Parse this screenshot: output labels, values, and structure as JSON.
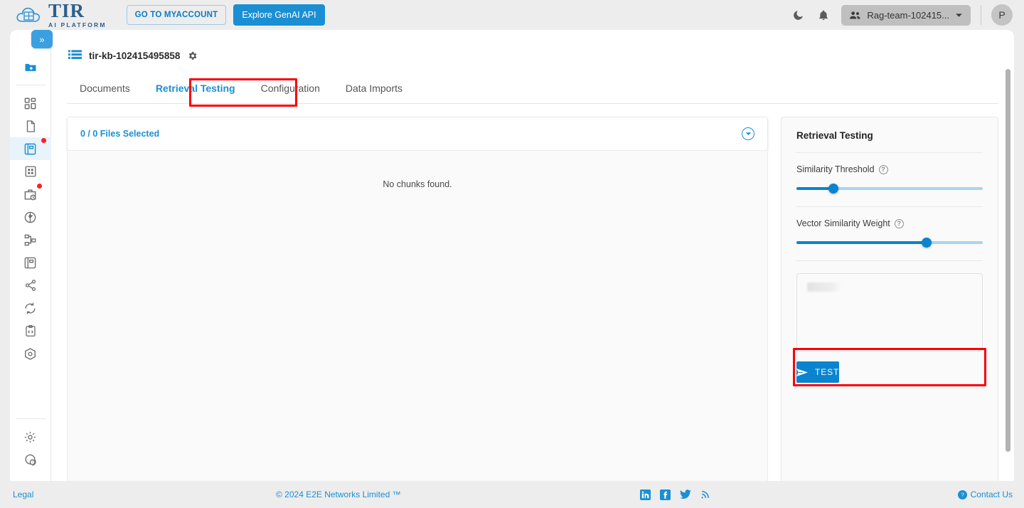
{
  "header": {
    "brand_name": "TIR",
    "brand_sub": "AI PLATFORM",
    "myaccount_label": "GO TO MYACCOUNT",
    "genai_label": "Explore GenAI API",
    "theme_icon": "moon-icon",
    "bell_icon": "bell-icon",
    "team_name": "Rag-team-102415...",
    "team_icon": "people-icon",
    "chevron_icon": "chevron-down-icon",
    "avatar_initial": "P"
  },
  "breadcrumb": {
    "text": ""
  },
  "sidebar": {
    "expander_glyph": "»",
    "items": [
      {
        "name": "new-project-folder",
        "icon": "folder-plus-icon",
        "badge": false,
        "active": false
      },
      {
        "name": "dashboard",
        "icon": "dashboard-grid-icon",
        "badge": false,
        "active": false
      },
      {
        "name": "documents",
        "icon": "file-icon",
        "badge": false,
        "active": false
      },
      {
        "name": "knowledge-base",
        "icon": "book-list-icon",
        "badge": true,
        "active": true
      },
      {
        "name": "datasets",
        "icon": "table-icon",
        "badge": false,
        "active": false
      },
      {
        "name": "jobs",
        "icon": "briefcase-clock-icon",
        "badge": true,
        "active": false
      },
      {
        "name": "inference",
        "icon": "target-node-icon",
        "badge": false,
        "active": false
      },
      {
        "name": "pipelines",
        "icon": "hierarchy-icon",
        "badge": false,
        "active": false
      },
      {
        "name": "registry",
        "icon": "contact-card-icon",
        "badge": false,
        "active": false
      },
      {
        "name": "share",
        "icon": "share-nodes-icon",
        "badge": false,
        "active": false
      },
      {
        "name": "sync",
        "icon": "refresh-cycle-icon",
        "badge": false,
        "active": false
      },
      {
        "name": "code-snippets",
        "icon": "code-clipboard-icon",
        "badge": false,
        "active": false
      },
      {
        "name": "containers",
        "icon": "cube-icon",
        "badge": false,
        "active": false
      }
    ],
    "bottom_items": [
      {
        "name": "settings",
        "icon": "gear-icon"
      },
      {
        "name": "support",
        "icon": "chat-help-icon"
      }
    ]
  },
  "page": {
    "kb_name": "tir-kb-102415495858",
    "kb_icon": "list-blue-icon",
    "settings_icon": "gear-icon",
    "tabs": [
      {
        "label": "Documents",
        "active": false
      },
      {
        "label": "Retrieval Testing",
        "active": true
      },
      {
        "label": "Configuration",
        "active": false
      },
      {
        "label": "Data Imports",
        "active": false
      }
    ]
  },
  "chunks": {
    "files_selected_label": "0 / 0 Files Selected",
    "collapse_icon": "circle-chevron-down-icon",
    "empty_message": "No chunks found."
  },
  "retrieval": {
    "title": "Retrieval Testing",
    "similarity_threshold": {
      "label": "Similarity Threshold",
      "help_icon": "question-circle-icon",
      "value_percent": 20
    },
    "vector_similarity_weight": {
      "label": "Vector Similarity Weight",
      "help_icon": "question-circle-icon",
      "value_percent": 70
    },
    "query_input": {
      "value": "",
      "placeholder": ""
    },
    "test_button": {
      "label": "TEST",
      "icon": "send-paper-plane-icon"
    }
  },
  "footer": {
    "legal": "Legal",
    "copyright": "© 2024 E2E Networks Limited ™",
    "social": [
      {
        "name": "linkedin-icon"
      },
      {
        "name": "facebook-icon"
      },
      {
        "name": "twitter-icon"
      },
      {
        "name": "rss-icon"
      }
    ],
    "contact": "Contact Us",
    "contact_icon": "question-circle-icon"
  },
  "colors": {
    "accent": "#1a8fd4",
    "slider_fill": "#0b84cf",
    "slider_track": "#a8d5f0",
    "highlight_box": "#fb0007",
    "chrome_bg": "#ededed"
  }
}
